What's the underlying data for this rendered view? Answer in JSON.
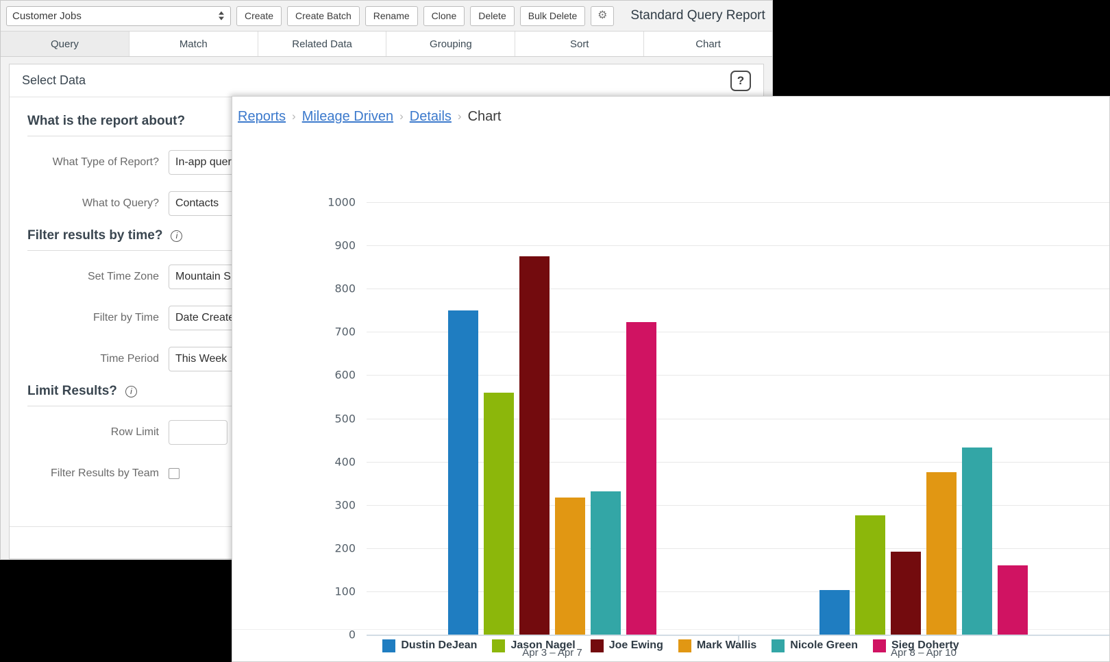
{
  "query_window": {
    "toolbar": {
      "object_select": {
        "value": "Customer Jobs",
        "icon": "sort-spinner-icon"
      },
      "buttons": [
        {
          "label": "Create",
          "name": "create-button"
        },
        {
          "label": "Create Batch",
          "name": "create-batch-button"
        },
        {
          "label": "Rename",
          "name": "rename-button"
        },
        {
          "label": "Clone",
          "name": "clone-button"
        },
        {
          "label": "Delete",
          "name": "delete-button"
        },
        {
          "label": "Bulk Delete",
          "name": "bulk-delete-button"
        }
      ],
      "settings_icon": "gear-icon",
      "gear_glyph": "⚙",
      "report_title": "Standard Query Report"
    },
    "tabs": [
      {
        "label": "Query",
        "active": true
      },
      {
        "label": "Match",
        "active": false
      },
      {
        "label": "Related Data",
        "active": false
      },
      {
        "label": "Grouping",
        "active": false
      },
      {
        "label": "Sort",
        "active": false
      },
      {
        "label": "Chart",
        "active": false
      }
    ],
    "panel": {
      "title": "Select Data",
      "help_icon": "question-mark-icon",
      "help_glyph": "?",
      "sections": [
        {
          "heading": "What is the report about?",
          "has_info": false,
          "fields": [
            {
              "label": "What Type of Report?",
              "value": "In-app quer",
              "type": "select"
            },
            {
              "label": "What to Query?",
              "value": "Contacts",
              "type": "select"
            }
          ]
        },
        {
          "heading": "Filter results by time?",
          "has_info": true,
          "info_glyph": "i",
          "fields": [
            {
              "label": "Set Time Zone",
              "value": "Mountain S",
              "type": "select"
            },
            {
              "label": "Filter by Time",
              "value": "Date Create",
              "type": "select"
            },
            {
              "label": "Time Period",
              "value": "This Week",
              "type": "select"
            }
          ]
        },
        {
          "heading": "Limit Results?",
          "has_info": true,
          "info_glyph": "i",
          "fields": [
            {
              "label": "Row Limit",
              "value": "",
              "type": "text"
            },
            {
              "label": "Filter Results by Team",
              "value": "",
              "type": "checkbox"
            }
          ]
        }
      ]
    }
  },
  "chart_window": {
    "breadcrumb": {
      "items": [
        {
          "label": "Reports",
          "link": true
        },
        {
          "label": "Mileage Driven",
          "link": true
        },
        {
          "label": "Details",
          "link": true
        },
        {
          "label": "Chart",
          "link": false
        }
      ],
      "separator": "›"
    }
  },
  "chart_data": {
    "type": "bar",
    "title": "Mileage Driven",
    "xlabel": "",
    "ylabel": "",
    "ylim": [
      0,
      1000
    ],
    "yticks": [
      0,
      100,
      200,
      300,
      400,
      500,
      600,
      700,
      800,
      900,
      1000
    ],
    "grid": true,
    "legend_position": "bottom",
    "categories": [
      "Apr 3 – Apr 7",
      "Apr 8 – Apr 10"
    ],
    "series": [
      {
        "name": "Dustin DeJean",
        "color": "#1F7DC1",
        "values": [
          750,
          103
        ]
      },
      {
        "name": "Jason Nagel",
        "color": "#8CB70B",
        "values": [
          560,
          275
        ]
      },
      {
        "name": "Joe Ewing",
        "color": "#730B0E",
        "values": [
          875,
          192
        ]
      },
      {
        "name": "Mark Wallis",
        "color": "#E19713",
        "values": [
          317,
          375
        ]
      },
      {
        "name": "Nicole Green",
        "color": "#33A6A6",
        "values": [
          332,
          433
        ]
      },
      {
        "name": "Sieg Doherty",
        "color": "#D01362",
        "values": [
          722,
          160
        ]
      }
    ]
  }
}
